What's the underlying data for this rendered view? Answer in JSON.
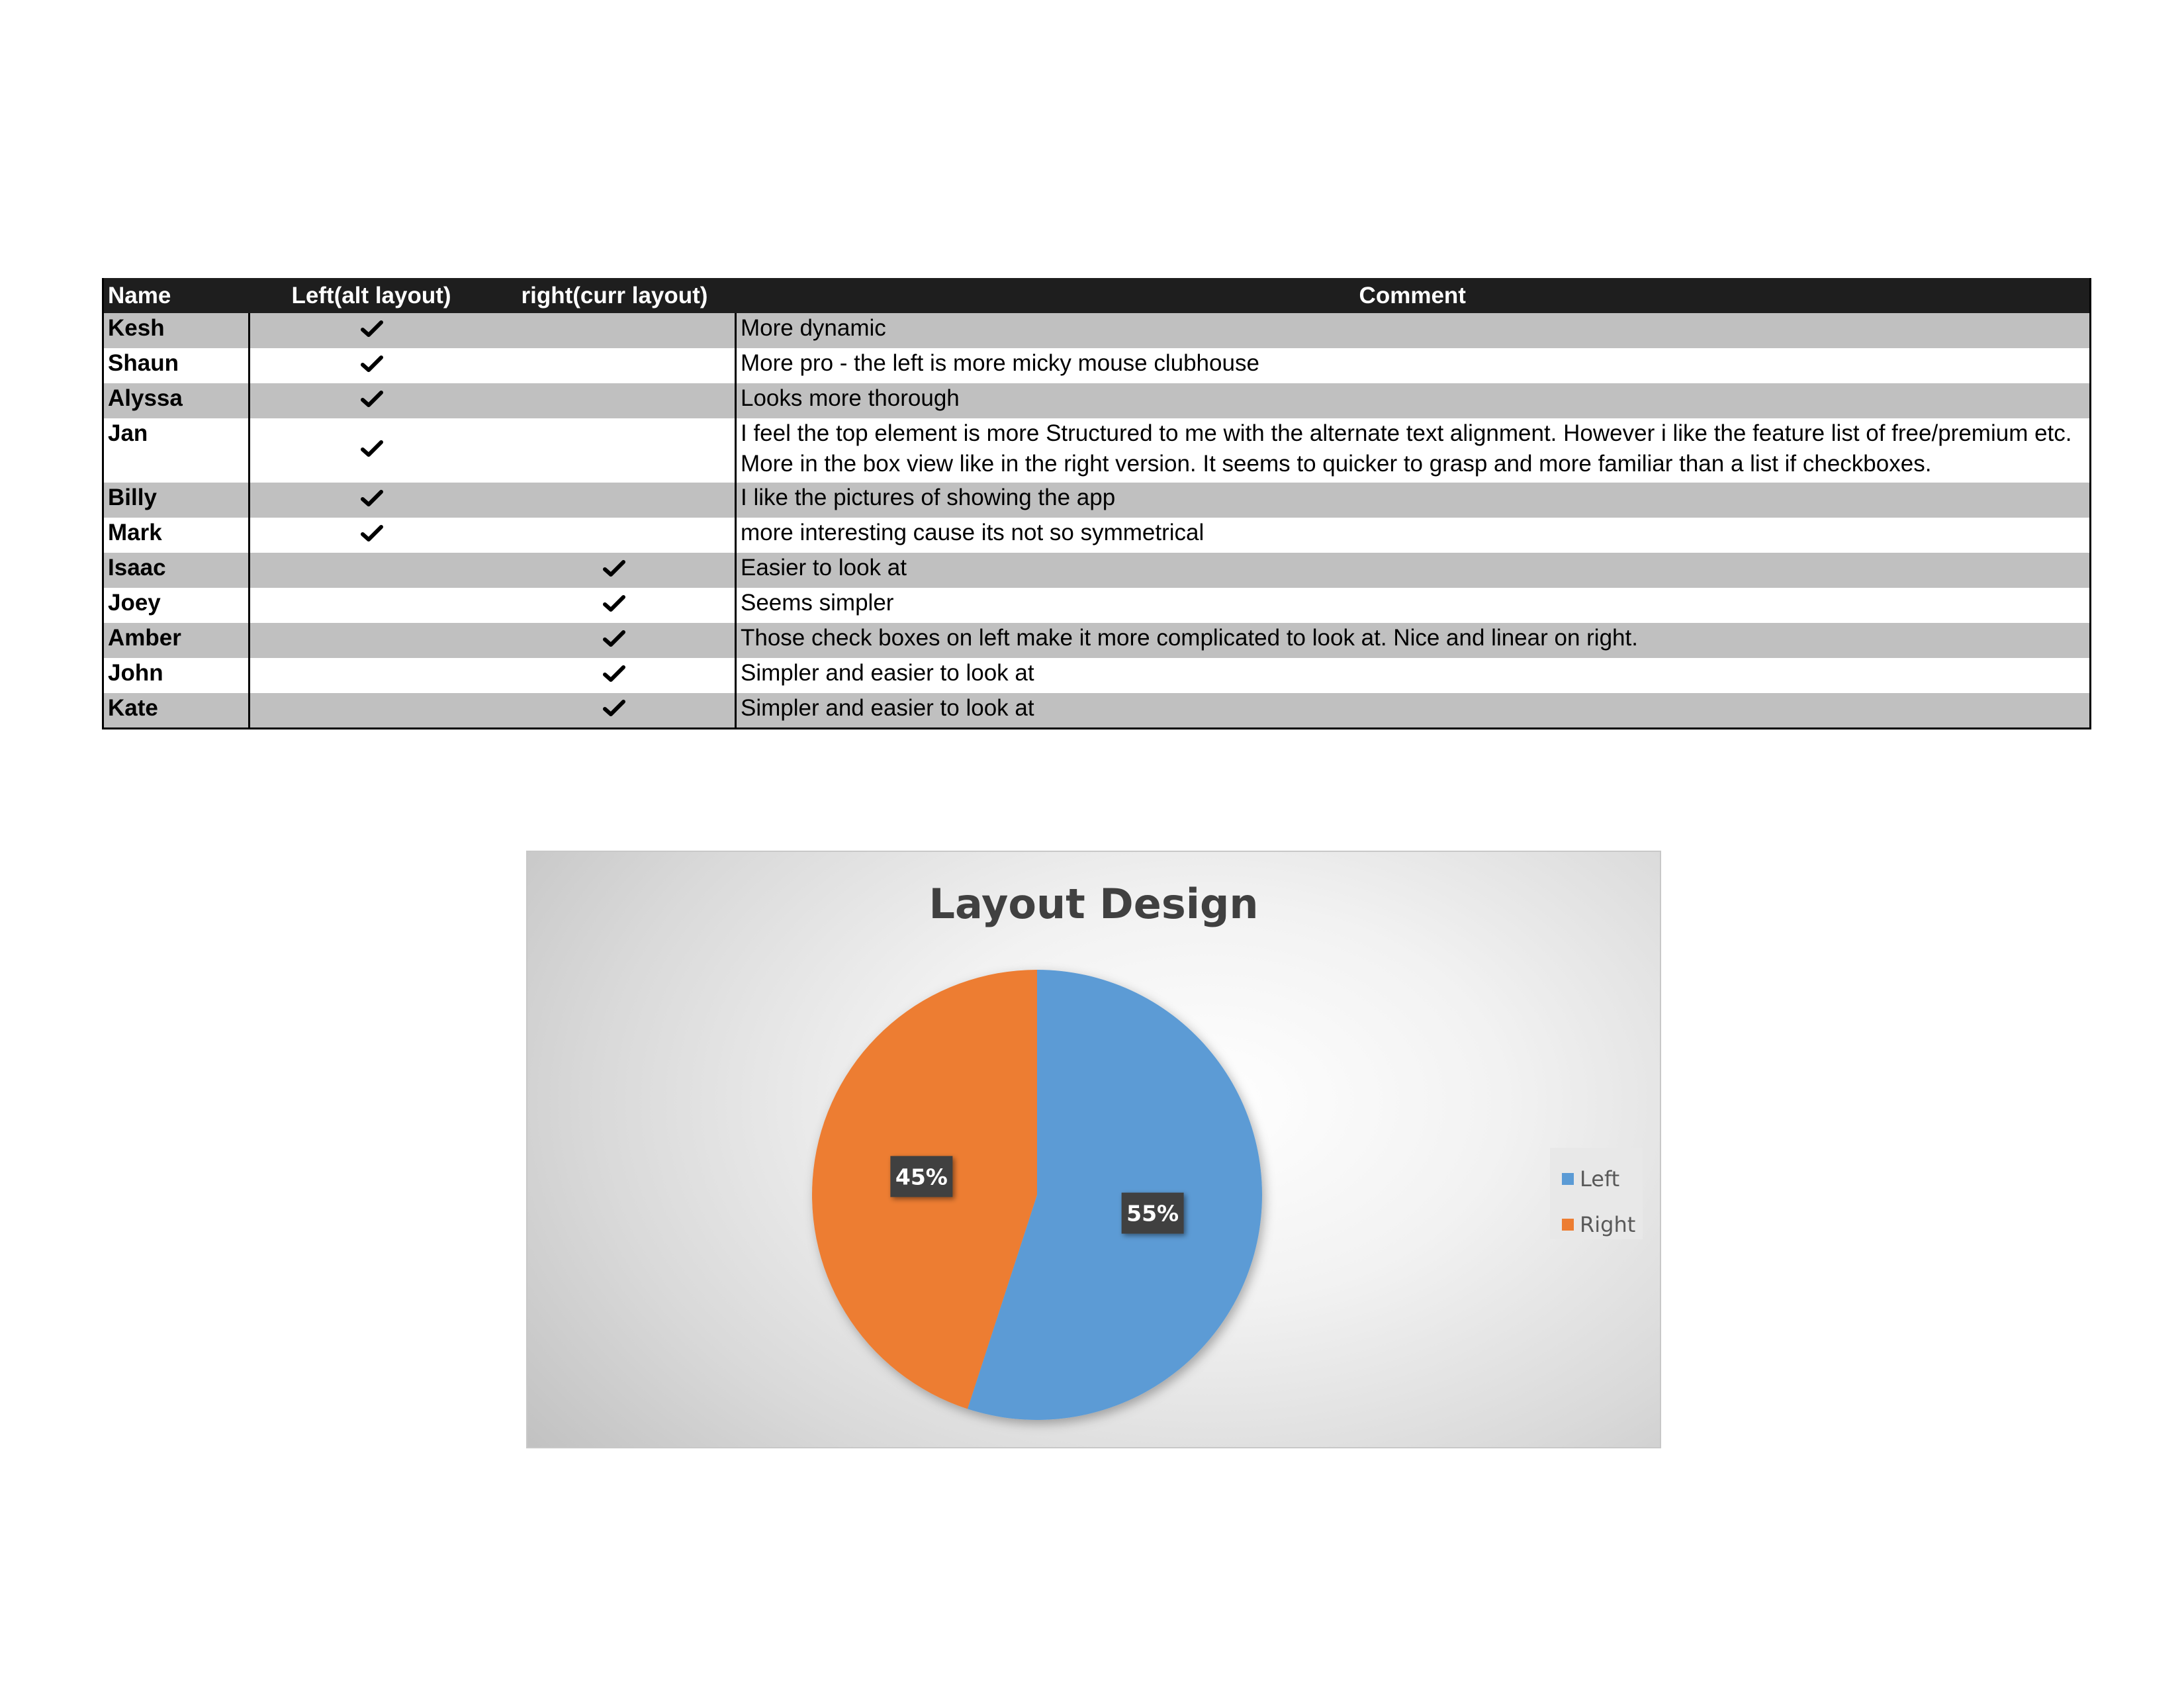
{
  "table": {
    "headers": {
      "name": "Name",
      "left": "Left(alt layout)",
      "right": "right(curr layout)",
      "comment": "Comment"
    },
    "rows": [
      {
        "name": "Kesh",
        "choice": "left",
        "comment": "More dynamic"
      },
      {
        "name": "Shaun",
        "choice": "left",
        "comment": "More pro - the left is more micky mouse clubhouse"
      },
      {
        "name": "Alyssa",
        "choice": "left",
        "comment": "Looks more thorough"
      },
      {
        "name": "Jan",
        "choice": "left",
        "comment": "I feel the top element is more Structured to me with the alternate text alignment. However i like the feature list of free/premium etc. More in the box view like in the right version. It seems to quicker to grasp and more familiar than a list if checkboxes."
      },
      {
        "name": "Billy",
        "choice": "left",
        "comment": "I like the pictures of showing the app"
      },
      {
        "name": "Mark",
        "choice": "left",
        "comment": "more interesting cause its not so symmetrical"
      },
      {
        "name": "Isaac",
        "choice": "right",
        "comment": "Easier to look at"
      },
      {
        "name": "Joey",
        "choice": "right",
        "comment": "Seems simpler"
      },
      {
        "name": "Amber",
        "choice": "right",
        "comment": "Those check boxes on left make it more complicated to look at.  Nice and linear on right."
      },
      {
        "name": "John",
        "choice": "right",
        "comment": "Simpler and easier to look at"
      },
      {
        "name": "Kate",
        "choice": "right",
        "comment": "Simpler and easier to look at"
      }
    ]
  },
  "chart_data": {
    "type": "pie",
    "title": "Layout Design",
    "categories": [
      "Left",
      "Right"
    ],
    "values": [
      55,
      45
    ],
    "data_labels": [
      "55%",
      "45%"
    ],
    "colors": [
      "#5b9bd5",
      "#ed7d31"
    ],
    "legend_position": "right"
  }
}
